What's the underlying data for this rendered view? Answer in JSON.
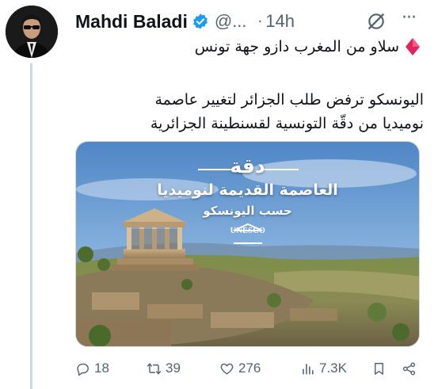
{
  "tweet": {
    "author_name": "Mahdi Baladi",
    "handle": "@...",
    "separator": "·",
    "time": "14h",
    "more_label": "···",
    "line1": "سلاو من المغرب دازو جهة تونس",
    "body_lines": [
      "اليونسكو ترفض طلب الجزائر لتغيير عاصمة",
      "نوميديا من دقّة التونسية لقسنطينة الجزائرية"
    ],
    "media": {
      "title": "دقة",
      "subtitle": "العاصمة القديمة لنوميديا",
      "subtitle2": "حسب اليونسكو",
      "logo_text": "UNESCO"
    },
    "actions": {
      "replies": "18",
      "retweets": "39",
      "likes": "276",
      "views": "7.3K"
    },
    "colors": {
      "verified": "#1d9bf0",
      "muted": "#536471",
      "diamond": "#e0245e"
    }
  }
}
